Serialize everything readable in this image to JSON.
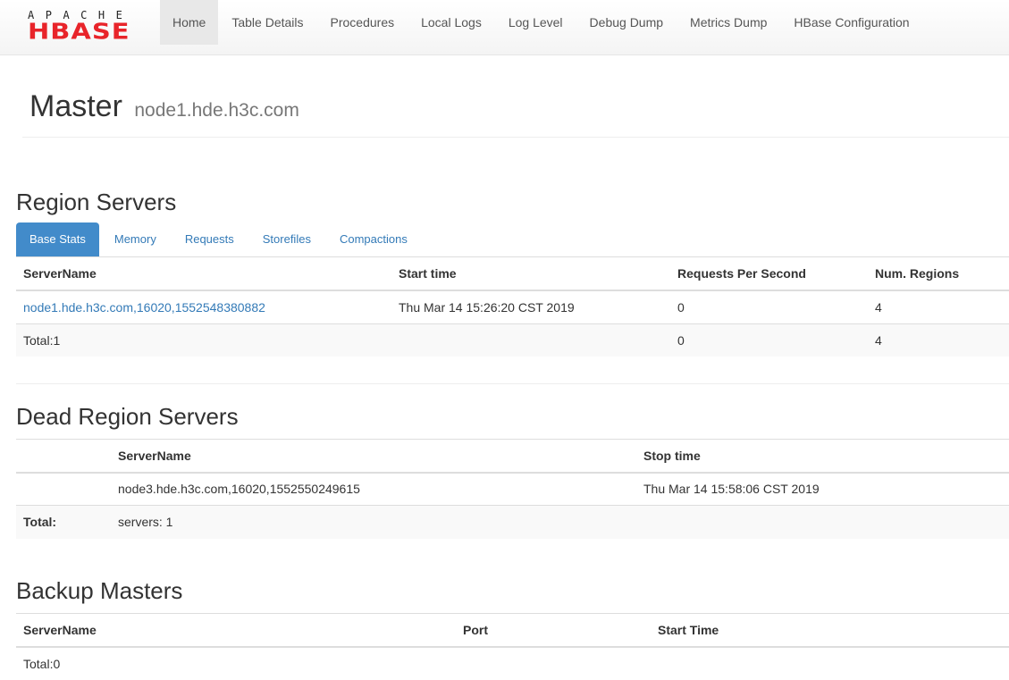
{
  "logo": {
    "top": "APACHE",
    "bottom": "HBASE"
  },
  "nav": [
    {
      "label": "Home",
      "active": true
    },
    {
      "label": "Table Details"
    },
    {
      "label": "Procedures"
    },
    {
      "label": "Local Logs"
    },
    {
      "label": "Log Level"
    },
    {
      "label": "Debug Dump"
    },
    {
      "label": "Metrics Dump"
    },
    {
      "label": "HBase Configuration"
    }
  ],
  "header": {
    "title": "Master",
    "host": "node1.hde.h3c.com"
  },
  "region_servers": {
    "title": "Region Servers",
    "tabs": [
      "Base Stats",
      "Memory",
      "Requests",
      "Storefiles",
      "Compactions"
    ],
    "columns": [
      "ServerName",
      "Start time",
      "Requests Per Second",
      "Num. Regions"
    ],
    "rows": [
      {
        "server": "node1.hde.h3c.com,16020,1552548380882",
        "start": "Thu Mar 14 15:26:20 CST 2019",
        "rps": "0",
        "regions": "4"
      }
    ],
    "total": {
      "label": "Total:1",
      "rps": "0",
      "regions": "4"
    }
  },
  "dead_region_servers": {
    "title": "Dead Region Servers",
    "columns": [
      "ServerName",
      "Stop time"
    ],
    "rows": [
      {
        "server": "node3.hde.h3c.com,16020,1552550249615",
        "stop": "Thu Mar 14 15:58:06 CST 2019"
      }
    ],
    "total": {
      "label": "Total:",
      "value": "servers: 1"
    }
  },
  "backup_masters": {
    "title": "Backup Masters",
    "columns": [
      "ServerName",
      "Port",
      "Start Time"
    ],
    "total": "Total:0"
  }
}
